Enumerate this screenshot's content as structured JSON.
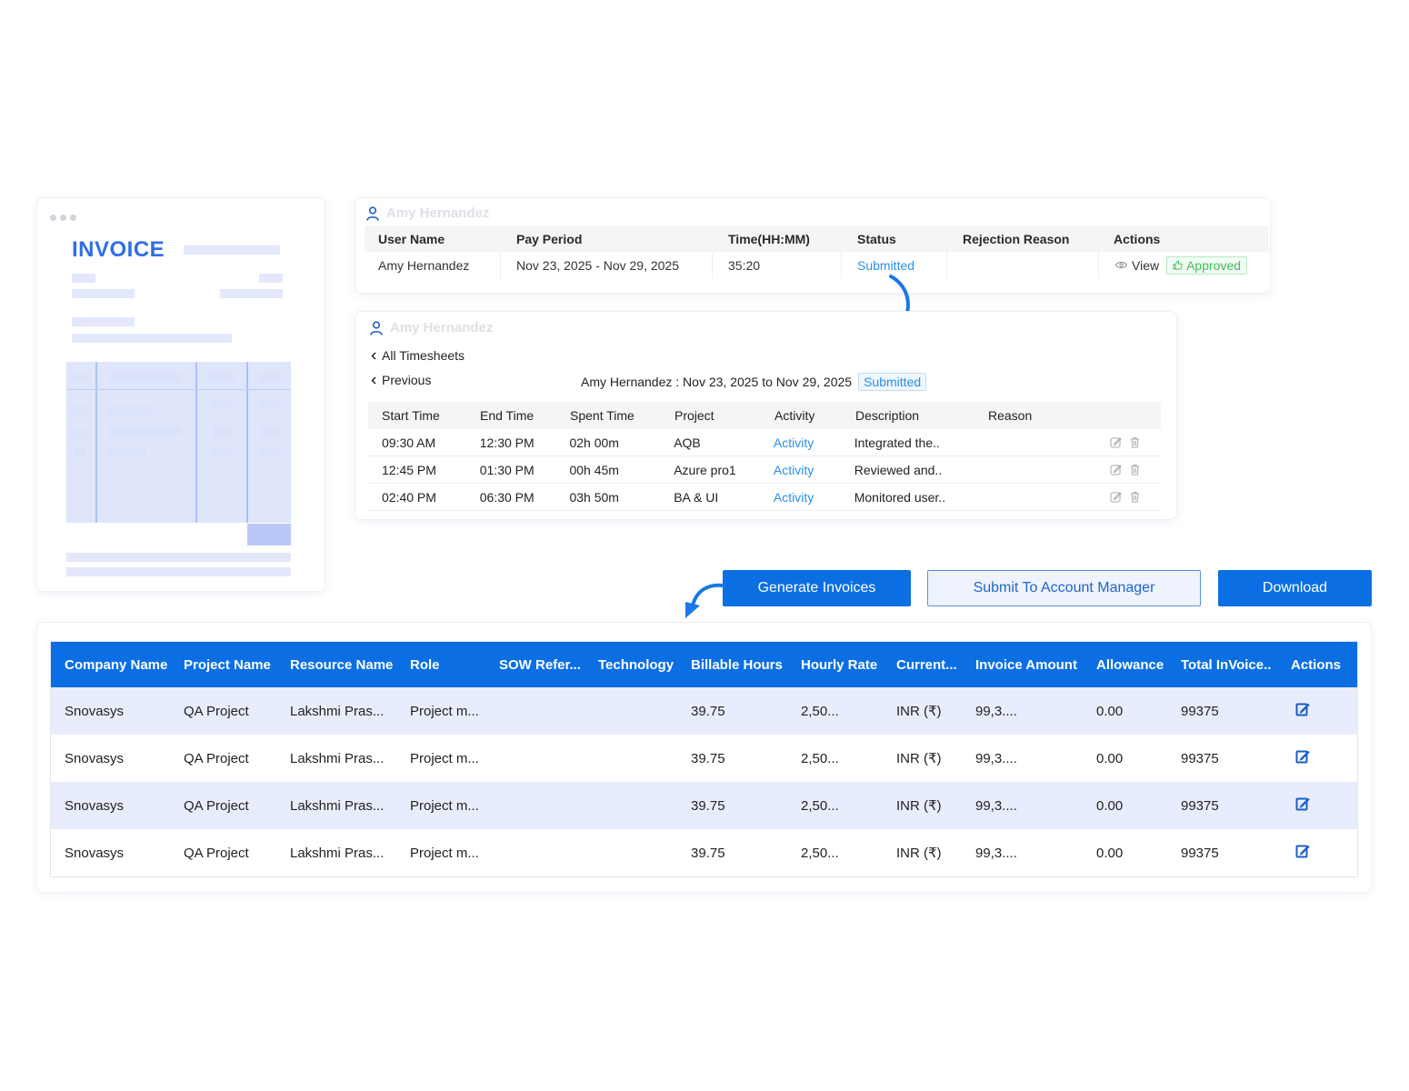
{
  "invoice_preview": {
    "title": "INVOICE"
  },
  "timesheet_summary": {
    "user_header": "Amy Hernandez",
    "columns": [
      "User Name",
      "Pay Period",
      "Time(HH:MM)",
      "Status",
      "Rejection Reason",
      "Actions"
    ],
    "row": {
      "user_name": "Amy Hernandez",
      "pay_period": "Nov 23, 2025  -  Nov 29, 2025",
      "time": "35:20",
      "status": "Submitted",
      "rejection_reason": "",
      "view_label": "View",
      "approved_label": "Approved"
    }
  },
  "timesheet_detail": {
    "user_header": "Amy Hernandez",
    "all_timesheets_label": "All Timesheets",
    "previous_label": "Previous",
    "period_text": "Amy Hernandez : Nov 23, 2025 to Nov 29, 2025",
    "status_badge": "Submitted",
    "columns": [
      "Start Time",
      "End Time",
      "Spent Time",
      "Project",
      "Activity",
      "Description",
      "Reason"
    ],
    "rows": [
      {
        "start": "09:30 AM",
        "end": "12:30 PM",
        "spent": "02h 00m",
        "project": "AQB",
        "activity": "Activity",
        "description": "Integrated the..",
        "reason": ""
      },
      {
        "start": "12:45 PM",
        "end": "01:30 PM",
        "spent": "00h 45m",
        "project": "Azure pro1",
        "activity": "Activity",
        "description": "Reviewed and..",
        "reason": ""
      },
      {
        "start": "02:40 PM",
        "end": "06:30 PM",
        "spent": "03h 50m",
        "project": "BA & UI",
        "activity": "Activity",
        "description": "Monitored user..",
        "reason": ""
      }
    ]
  },
  "actions": {
    "generate_invoices": "Generate Invoices",
    "submit_to_account_manager": "Submit To Account Manager",
    "download": "Download"
  },
  "invoice_table": {
    "columns": [
      "Company Name",
      "Project Name",
      "Resource Name",
      "Role",
      "SOW Refer...",
      "Technology",
      "Billable Hours",
      "Hourly Rate",
      "Current...",
      "Invoice Amount",
      "Allowance",
      "Total InVoice..",
      "Actions"
    ],
    "rows": [
      {
        "company": "Snovasys",
        "project": "QA Project",
        "resource": "Lakshmi Pras...",
        "role": "Project m...",
        "sow": "",
        "technology": "",
        "billable_hours": "39.75",
        "hourly_rate": "2,50...",
        "currency": "INR (₹)",
        "invoice_amount": "99,3....",
        "allowance": "0.00",
        "total_invoice": "99375"
      },
      {
        "company": "Snovasys",
        "project": "QA Project",
        "resource": "Lakshmi Pras...",
        "role": "Project m...",
        "sow": "",
        "technology": "",
        "billable_hours": "39.75",
        "hourly_rate": "2,50...",
        "currency": "INR (₹)",
        "invoice_amount": "99,3....",
        "allowance": "0.00",
        "total_invoice": "99375"
      },
      {
        "company": "Snovasys",
        "project": "QA Project",
        "resource": "Lakshmi Pras...",
        "role": "Project m...",
        "sow": "",
        "technology": "",
        "billable_hours": "39.75",
        "hourly_rate": "2,50...",
        "currency": "INR (₹)",
        "invoice_amount": "99,3....",
        "allowance": "0.00",
        "total_invoice": "99375"
      },
      {
        "company": "Snovasys",
        "project": "QA Project",
        "resource": "Lakshmi Pras...",
        "role": "Project m...",
        "sow": "",
        "technology": "",
        "billable_hours": "39.75",
        "hourly_rate": "2,50...",
        "currency": "INR (₹)",
        "invoice_amount": "99,3....",
        "allowance": "0.00",
        "total_invoice": "99375"
      }
    ]
  },
  "colors": {
    "primary": "#0b6fe3",
    "link": "#2a90e8",
    "approved": "#3fbf56",
    "row_alt": "#e8edfd"
  },
  "icons": [
    "user-icon",
    "eye-icon",
    "thumbs-up-icon",
    "edit-icon",
    "delete-icon",
    "chevron-left-icon",
    "curved-arrow-icon"
  ]
}
